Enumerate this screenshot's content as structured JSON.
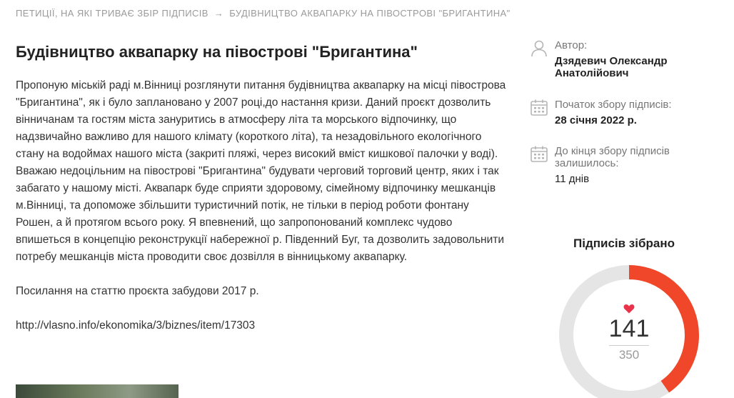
{
  "breadcrumb": {
    "parent": "ПЕТИЦІЇ, НА ЯКІ ТРИВАЄ ЗБІР ПІДПИСІВ",
    "separator": "→",
    "current": "БУДІВНИЦТВО АКВАПАРКУ НА ПІВОСТРОВІ \"БРИГАНТИНА\""
  },
  "petition": {
    "title": "Будівництво аквапарку на півострові \"Бригантина\"",
    "paragraph1": "Пропоную міській раді м.Вінниці розглянути питання будівництва аквапарку на місці півострова \"Бригантина\", як і було заплановано у 2007 році,до настання кризи. Даний проєкт дозволить вінничанам та гостям міста зануритись в атмосферу літа та морського відпочинку, що надзвичайно важливо для нашого клімату (короткого літа), та незадовільного екологічного стану на водоймах нашого міста (закриті пляжі, через високий вміст кишкової палочки у воді). Вважаю недоцільним на півострові \"Бригантина\" будувати черговий торговий центр, яких і так забагато у нашому місті. Аквапарк буде сприяти здоровому, сімейному відпочинку мешканців м.Вінниці, та допоможе збільшити туристичний потік, не тільки в період роботи фонтану Рошен, а й протягом всього року. Я впевнений, що запропонований комплекс чудово впишеться в концепцію реконструкції набережної р. Південний Буг, та дозволить задовольнити потребу мешканців міста проводити своє дозвілля в вінницькому аквапарку.",
    "paragraph2": "Посилання на статтю проєкта забудови 2017 р.",
    "link": "http://vlasno.info/ekonomika/3/biznes/item/17303"
  },
  "sidebar": {
    "author_label": "Автор:",
    "author_name": "Дзядевич Олександр Анатолійович",
    "start_label": "Початок збору підписів:",
    "start_date": "28 січня 2022 р.",
    "remaining_label": "До кінця збору підписів залишилось:",
    "remaining_value": "11 днів",
    "icons": {
      "author": "user-icon",
      "start": "calendar-icon",
      "remaining": "calendar-icon"
    }
  },
  "signatures": {
    "title": "Підписів зібрано",
    "collected": 141,
    "goal": 350,
    "colors": {
      "progress": "#f0472a",
      "track": "#e5e5e5",
      "heart": "#e8334a"
    }
  }
}
